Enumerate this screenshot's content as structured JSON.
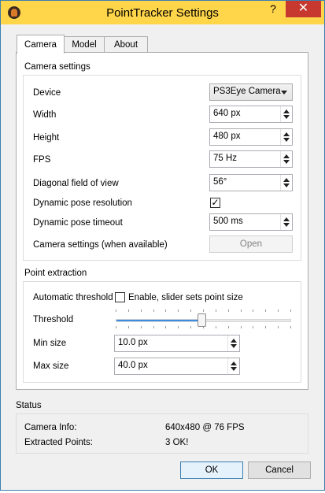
{
  "colors": {
    "titlebar_bg": "#ffd54a",
    "close_bg": "#c7392f",
    "accent": "#3c7fb1",
    "slider_fill": "#3c8ddf"
  },
  "window": {
    "title": "PointTracker Settings",
    "help_glyph": "?",
    "close_glyph": "✕",
    "app_icon": "pointtracker-head-icon"
  },
  "tabs": [
    "Camera",
    "Model",
    "About"
  ],
  "camera_settings": {
    "title": "Camera settings",
    "device": {
      "label": "Device",
      "value": "PS3Eye Camera"
    },
    "width": {
      "label": "Width",
      "value": "640 px"
    },
    "height": {
      "label": "Height",
      "value": "480 px"
    },
    "fps": {
      "label": "FPS",
      "value": "75 Hz"
    },
    "fov": {
      "label": "Diagonal field of view",
      "value": "56°"
    },
    "dynamic_pose_resolution": {
      "label": "Dynamic pose resolution",
      "checked": true,
      "mark": "✓"
    },
    "dynamic_pose_timeout": {
      "label": "Dynamic pose timeout",
      "value": "500 ms"
    },
    "camera_settings_when_available": {
      "label": "Camera settings (when available)",
      "button": "Open"
    }
  },
  "point_extraction": {
    "title": "Point extraction",
    "auto_threshold": {
      "label": "Automatic threshold",
      "checkbox_label": "Enable, slider sets point size",
      "checked": false
    },
    "threshold": {
      "label": "Threshold",
      "level": 0.49
    },
    "min_size": {
      "label": "Min size",
      "value": "10.0 px"
    },
    "max_size": {
      "label": "Max size",
      "value": "40.0 px"
    }
  },
  "status": {
    "title": "Status",
    "camera_info": {
      "label": "Camera Info:",
      "value": "640x480 @ 76 FPS"
    },
    "extracted_points": {
      "label": "Extracted Points:",
      "value": "3 OK!"
    }
  },
  "buttons": {
    "ok": "OK",
    "cancel": "Cancel"
  }
}
